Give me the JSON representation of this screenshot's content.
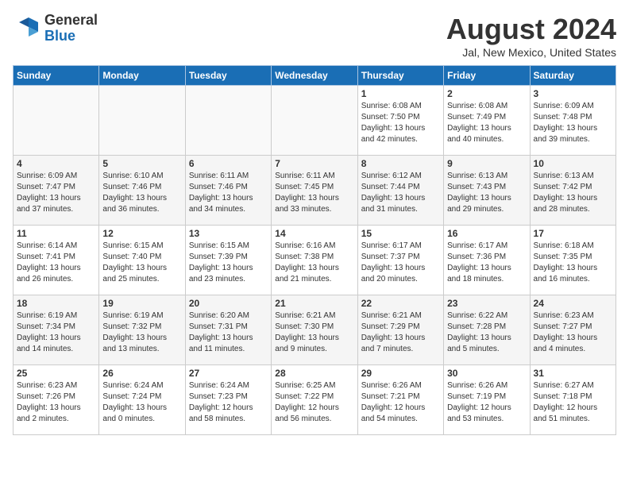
{
  "header": {
    "logo_line1": "General",
    "logo_line2": "Blue",
    "month_title": "August 2024",
    "location": "Jal, New Mexico, United States"
  },
  "weekdays": [
    "Sunday",
    "Monday",
    "Tuesday",
    "Wednesday",
    "Thursday",
    "Friday",
    "Saturday"
  ],
  "weeks": [
    [
      {
        "day": "",
        "info": ""
      },
      {
        "day": "",
        "info": ""
      },
      {
        "day": "",
        "info": ""
      },
      {
        "day": "",
        "info": ""
      },
      {
        "day": "1",
        "info": "Sunrise: 6:08 AM\nSunset: 7:50 PM\nDaylight: 13 hours\nand 42 minutes."
      },
      {
        "day": "2",
        "info": "Sunrise: 6:08 AM\nSunset: 7:49 PM\nDaylight: 13 hours\nand 40 minutes."
      },
      {
        "day": "3",
        "info": "Sunrise: 6:09 AM\nSunset: 7:48 PM\nDaylight: 13 hours\nand 39 minutes."
      }
    ],
    [
      {
        "day": "4",
        "info": "Sunrise: 6:09 AM\nSunset: 7:47 PM\nDaylight: 13 hours\nand 37 minutes."
      },
      {
        "day": "5",
        "info": "Sunrise: 6:10 AM\nSunset: 7:46 PM\nDaylight: 13 hours\nand 36 minutes."
      },
      {
        "day": "6",
        "info": "Sunrise: 6:11 AM\nSunset: 7:46 PM\nDaylight: 13 hours\nand 34 minutes."
      },
      {
        "day": "7",
        "info": "Sunrise: 6:11 AM\nSunset: 7:45 PM\nDaylight: 13 hours\nand 33 minutes."
      },
      {
        "day": "8",
        "info": "Sunrise: 6:12 AM\nSunset: 7:44 PM\nDaylight: 13 hours\nand 31 minutes."
      },
      {
        "day": "9",
        "info": "Sunrise: 6:13 AM\nSunset: 7:43 PM\nDaylight: 13 hours\nand 29 minutes."
      },
      {
        "day": "10",
        "info": "Sunrise: 6:13 AM\nSunset: 7:42 PM\nDaylight: 13 hours\nand 28 minutes."
      }
    ],
    [
      {
        "day": "11",
        "info": "Sunrise: 6:14 AM\nSunset: 7:41 PM\nDaylight: 13 hours\nand 26 minutes."
      },
      {
        "day": "12",
        "info": "Sunrise: 6:15 AM\nSunset: 7:40 PM\nDaylight: 13 hours\nand 25 minutes."
      },
      {
        "day": "13",
        "info": "Sunrise: 6:15 AM\nSunset: 7:39 PM\nDaylight: 13 hours\nand 23 minutes."
      },
      {
        "day": "14",
        "info": "Sunrise: 6:16 AM\nSunset: 7:38 PM\nDaylight: 13 hours\nand 21 minutes."
      },
      {
        "day": "15",
        "info": "Sunrise: 6:17 AM\nSunset: 7:37 PM\nDaylight: 13 hours\nand 20 minutes."
      },
      {
        "day": "16",
        "info": "Sunrise: 6:17 AM\nSunset: 7:36 PM\nDaylight: 13 hours\nand 18 minutes."
      },
      {
        "day": "17",
        "info": "Sunrise: 6:18 AM\nSunset: 7:35 PM\nDaylight: 13 hours\nand 16 minutes."
      }
    ],
    [
      {
        "day": "18",
        "info": "Sunrise: 6:19 AM\nSunset: 7:34 PM\nDaylight: 13 hours\nand 14 minutes."
      },
      {
        "day": "19",
        "info": "Sunrise: 6:19 AM\nSunset: 7:32 PM\nDaylight: 13 hours\nand 13 minutes."
      },
      {
        "day": "20",
        "info": "Sunrise: 6:20 AM\nSunset: 7:31 PM\nDaylight: 13 hours\nand 11 minutes."
      },
      {
        "day": "21",
        "info": "Sunrise: 6:21 AM\nSunset: 7:30 PM\nDaylight: 13 hours\nand 9 minutes."
      },
      {
        "day": "22",
        "info": "Sunrise: 6:21 AM\nSunset: 7:29 PM\nDaylight: 13 hours\nand 7 minutes."
      },
      {
        "day": "23",
        "info": "Sunrise: 6:22 AM\nSunset: 7:28 PM\nDaylight: 13 hours\nand 5 minutes."
      },
      {
        "day": "24",
        "info": "Sunrise: 6:23 AM\nSunset: 7:27 PM\nDaylight: 13 hours\nand 4 minutes."
      }
    ],
    [
      {
        "day": "25",
        "info": "Sunrise: 6:23 AM\nSunset: 7:26 PM\nDaylight: 13 hours\nand 2 minutes."
      },
      {
        "day": "26",
        "info": "Sunrise: 6:24 AM\nSunset: 7:24 PM\nDaylight: 13 hours\nand 0 minutes."
      },
      {
        "day": "27",
        "info": "Sunrise: 6:24 AM\nSunset: 7:23 PM\nDaylight: 12 hours\nand 58 minutes."
      },
      {
        "day": "28",
        "info": "Sunrise: 6:25 AM\nSunset: 7:22 PM\nDaylight: 12 hours\nand 56 minutes."
      },
      {
        "day": "29",
        "info": "Sunrise: 6:26 AM\nSunset: 7:21 PM\nDaylight: 12 hours\nand 54 minutes."
      },
      {
        "day": "30",
        "info": "Sunrise: 6:26 AM\nSunset: 7:19 PM\nDaylight: 12 hours\nand 53 minutes."
      },
      {
        "day": "31",
        "info": "Sunrise: 6:27 AM\nSunset: 7:18 PM\nDaylight: 12 hours\nand 51 minutes."
      }
    ]
  ]
}
